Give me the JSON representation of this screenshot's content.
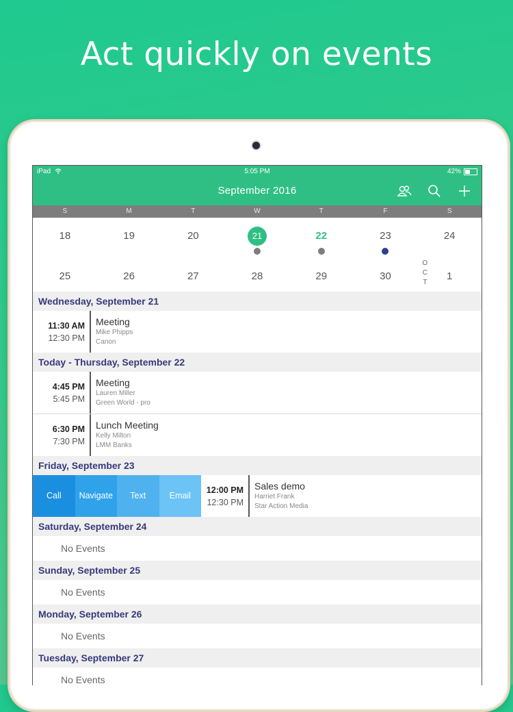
{
  "promo": {
    "title": "Act quickly on events"
  },
  "status_bar": {
    "device": "iPad",
    "time": "5:05 PM",
    "battery": "42%",
    "battery_level": 0.42
  },
  "nav": {
    "title": "September 2016",
    "icons": [
      "people-icon",
      "search-icon",
      "plus-icon"
    ]
  },
  "weekdays": [
    "S",
    "M",
    "T",
    "W",
    "T",
    "F",
    "S"
  ],
  "month_grid": {
    "week1": [
      "18",
      "19",
      "20",
      "21",
      "22",
      "23",
      "24"
    ],
    "week2": [
      "25",
      "26",
      "27",
      "28",
      "29",
      "30",
      "1"
    ],
    "next_month_abbr": [
      "O",
      "C",
      "T"
    ]
  },
  "sections": {
    "wed": {
      "header": "Wednesday, September 21",
      "events": [
        {
          "start": "11:30 AM",
          "end": "12:30 PM",
          "title": "Meeting",
          "person": "Mike Phipps",
          "company": "Canon"
        }
      ]
    },
    "thu": {
      "header": "Today - Thursday, September 22",
      "events": [
        {
          "start": "4:45 PM",
          "end": "5:45 PM",
          "title": "Meeting",
          "person": "Lauren Miller",
          "company": "Green World - pro"
        },
        {
          "start": "6:30 PM",
          "end": "7:30 PM",
          "title": "Lunch Meeting",
          "person": "Kelly Milton",
          "company": "LMM Banks"
        }
      ]
    },
    "fri": {
      "header": "Friday, September 23",
      "actions": [
        "Call",
        "Navigate",
        "Text",
        "Email"
      ],
      "events": [
        {
          "start": "12:00 PM",
          "end": "12:30 PM",
          "title": "Sales demo",
          "person": "Harriet Frank",
          "company": "Star Action Media"
        }
      ]
    },
    "sat": {
      "header": "Saturday, September 24",
      "empty": "No Events"
    },
    "sun": {
      "header": "Sunday, September 25",
      "empty": "No Events"
    },
    "mon": {
      "header": "Monday, September 26",
      "empty": "No Events"
    },
    "tue": {
      "header": "Tuesday, September 27",
      "empty": "No Events"
    }
  },
  "colors": {
    "brand_green": "#2fbf85",
    "header_text": "#35397a",
    "call": "#1a8fe0",
    "navigate": "#2fa2ea",
    "text": "#4fb2ef",
    "email": "#6cc3f5"
  }
}
